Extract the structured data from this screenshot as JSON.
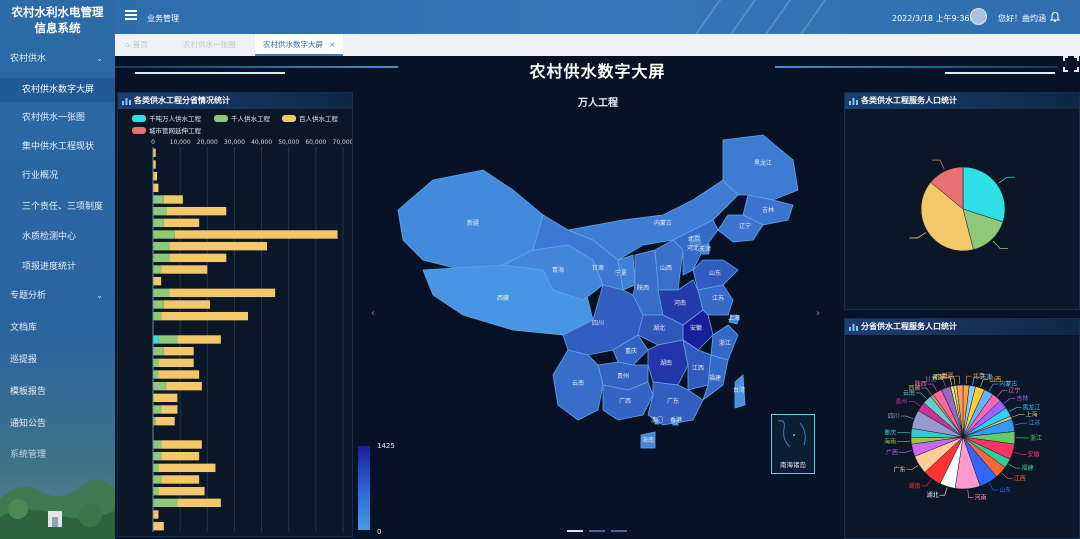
{
  "app": {
    "title_line1": "农村水利水电管理",
    "title_line2": "信息系统"
  },
  "sidebar": {
    "items": [
      {
        "label": "农村供水",
        "level": 1,
        "has_chevron": true
      },
      {
        "label": "农村供水数字大屏",
        "level": 2,
        "active": true
      },
      {
        "label": "农村供水一张图",
        "level": 2
      },
      {
        "label": "集中供水工程现状",
        "level": 2
      },
      {
        "label": "行业概况",
        "level": 2
      },
      {
        "label": "三个责任、三项制度",
        "level": 2,
        "has_chevron": true
      },
      {
        "label": "水质检测中心",
        "level": 2
      },
      {
        "label": "项报进度统计",
        "level": 2
      },
      {
        "label": "专题分析",
        "level": 1,
        "has_chevron": true
      },
      {
        "label": "文档库",
        "level": 1
      },
      {
        "label": "巡提报",
        "level": 1
      },
      {
        "label": "模板报告",
        "level": 1
      },
      {
        "label": "通知公告",
        "level": 1
      },
      {
        "label": "系统管理",
        "level": 1
      }
    ]
  },
  "topbar": {
    "menu_label": "业务管理",
    "datetime": "2022/3/18 上午9:36:33",
    "greeting": "您好！曲灼涵"
  },
  "tabs": [
    {
      "label": "首页",
      "active": false
    },
    {
      "label": "农村供水一张图",
      "active": false
    },
    {
      "label": "农村供水数字大屏",
      "active": true,
      "close": "×"
    }
  ],
  "screen": {
    "title": "农村供水数字大屏"
  },
  "left_panel": {
    "title": "各类供水工程分省情况统计",
    "legend": [
      {
        "label": "千吨万人供水工程",
        "color": "#2fe0e6"
      },
      {
        "label": "千人供水工程",
        "color": "#8fc879"
      },
      {
        "label": "百人供水工程",
        "color": "#f3c86a"
      },
      {
        "label": "城市管网延伸工程",
        "color": "#e87272"
      }
    ]
  },
  "map": {
    "title": "万人工程",
    "visual_map": {
      "max": "1425",
      "min": "0"
    },
    "south_sea_label": "南海诸岛",
    "nav_left": "‹",
    "nav_right": "›",
    "provinces": [
      {
        "name": "新疆",
        "value": 180
      },
      {
        "name": "西藏",
        "value": 60
      },
      {
        "name": "青海",
        "value": 220
      },
      {
        "name": "甘肃",
        "value": 380
      },
      {
        "name": "内蒙古",
        "value": 330
      },
      {
        "name": "黑龙江",
        "value": 360
      },
      {
        "name": "吉林",
        "value": 420
      },
      {
        "name": "辽宁",
        "value": 430
      },
      {
        "name": "宁夏",
        "value": 300
      },
      {
        "name": "陕西",
        "value": 520
      },
      {
        "name": "山西",
        "value": 480
      },
      {
        "name": "河北",
        "value": 560
      },
      {
        "name": "北京",
        "value": 300
      },
      {
        "name": "天津",
        "value": 300
      },
      {
        "name": "山东",
        "value": 720
      },
      {
        "name": "河南",
        "value": 1100
      },
      {
        "name": "江苏",
        "value": 560
      },
      {
        "name": "安徽",
        "value": 1425
      },
      {
        "name": "上海",
        "value": 200
      },
      {
        "name": "浙江",
        "value": 600
      },
      {
        "name": "湖北",
        "value": 780
      },
      {
        "name": "四川",
        "value": 700
      },
      {
        "name": "重庆",
        "value": 640
      },
      {
        "name": "湖南",
        "value": 1150
      },
      {
        "name": "江西",
        "value": 740
      },
      {
        "name": "贵州",
        "value": 640
      },
      {
        "name": "云南",
        "value": 520
      },
      {
        "name": "广西",
        "value": 620
      },
      {
        "name": "广东",
        "value": 700
      },
      {
        "name": "福建",
        "value": 560
      },
      {
        "name": "台湾",
        "value": 100
      },
      {
        "name": "海南",
        "value": 220
      },
      {
        "name": "澳门",
        "value": 40
      },
      {
        "name": "香港",
        "value": 40
      }
    ]
  },
  "right_top_panel": {
    "title": "各类供水工程服务人口统计"
  },
  "right_bottom_panel": {
    "title": "分省供水工程服务人口统计"
  },
  "chart_data": [
    {
      "type": "bar",
      "orientation": "horizontal",
      "stacked": true,
      "x_ticks": [
        "0",
        "10,000",
        "20,000",
        "30,000",
        "40,000",
        "50,000",
        "60,000",
        "70,000"
      ],
      "xlim": [
        0,
        70000
      ],
      "series": [
        {
          "name": "千吨万人供水工程",
          "color": "#2fe0e6",
          "values": [
            0,
            0,
            0,
            0,
            0,
            0,
            0,
            0,
            0,
            0,
            0,
            0,
            0,
            0,
            0,
            0,
            0,
            0,
            0,
            0,
            0,
            0,
            0,
            0,
            0,
            0,
            0,
            0,
            0,
            0,
            0,
            0,
            0,
            0,
            0,
            0,
            0,
            0,
            0,
            0,
            0,
            0,
            0,
            0,
            0,
            0,
            0,
            0,
            0,
            0,
            0,
            0,
            0,
            0,
            0,
            0,
            0,
            0,
            0,
            0,
            0,
            0,
            0,
            0,
            0,
            0,
            0,
            0,
            0,
            0,
            0,
            0,
            0,
            0,
            0,
            0,
            0,
            0,
            0,
            0,
            0,
            0,
            0,
            0,
            0,
            0,
            0,
            0
          ]
        },
        {
          "name": "千人供水工程",
          "color": "#8fc879",
          "values": []
        },
        {
          "name": "百人供水工程",
          "color": "#f3c86a",
          "values": []
        },
        {
          "name": "城市管网延伸工程",
          "color": "#e87272",
          "values": []
        }
      ]
    },
    {
      "type": "pie",
      "title": "各类供水工程服务人口统计",
      "series": [
        {
          "name": "千吨万人供水工程",
          "value": 30,
          "color": "#2fe0e6"
        },
        {
          "name": "千人供水工程",
          "value": 16,
          "color": "#8fc879"
        },
        {
          "name": "百人供水工程",
          "value": 40,
          "color": "#f3c86a"
        },
        {
          "name": "城市管网延伸工程",
          "value": 14,
          "color": "#e87272"
        }
      ]
    },
    {
      "type": "pie",
      "title": "分省供水工程服务人口统计",
      "labels": [
        "北京",
        "天津",
        "山西",
        "内蒙古",
        "辽宁",
        "吉林",
        "黑龙江",
        "上海",
        "江苏",
        "浙江",
        "安徽",
        "福建",
        "江西",
        "山东",
        "河南",
        "湖北",
        "湖南",
        "广东",
        "广西",
        "海南",
        "重庆",
        "四川",
        "贵州",
        "云南",
        "西藏",
        "陕西",
        "甘肃",
        "青海",
        "宁夏",
        "新疆"
      ],
      "values": [
        2,
        2,
        3,
        3,
        3,
        3,
        3,
        1,
        4,
        4,
        5,
        3,
        4,
        6,
        8,
        5,
        6,
        6,
        4,
        2,
        3,
        6,
        3,
        3,
        1,
        3,
        3,
        1,
        1,
        2
      ],
      "colors": [
        "#ff9f40",
        "#7fd0ff",
        "#ffcc33",
        "#66b3ff",
        "#ff66b3",
        "#9966ff",
        "#33ccff",
        "#cccc66",
        "#3399ff",
        "#66cc66",
        "#ff3366",
        "#33cc99",
        "#ff6633",
        "#3366ff",
        "#ff99cc",
        "#ffffff",
        "#ff3333",
        "#ffcc99",
        "#cc66ff",
        "#99cc33",
        "#33cccc",
        "#9999cc",
        "#cc3399",
        "#66cccc",
        "#cc9966",
        "#ff6699",
        "#9966cc",
        "#ccff66",
        "#ffcc66",
        "#ff9966"
      ]
    }
  ]
}
